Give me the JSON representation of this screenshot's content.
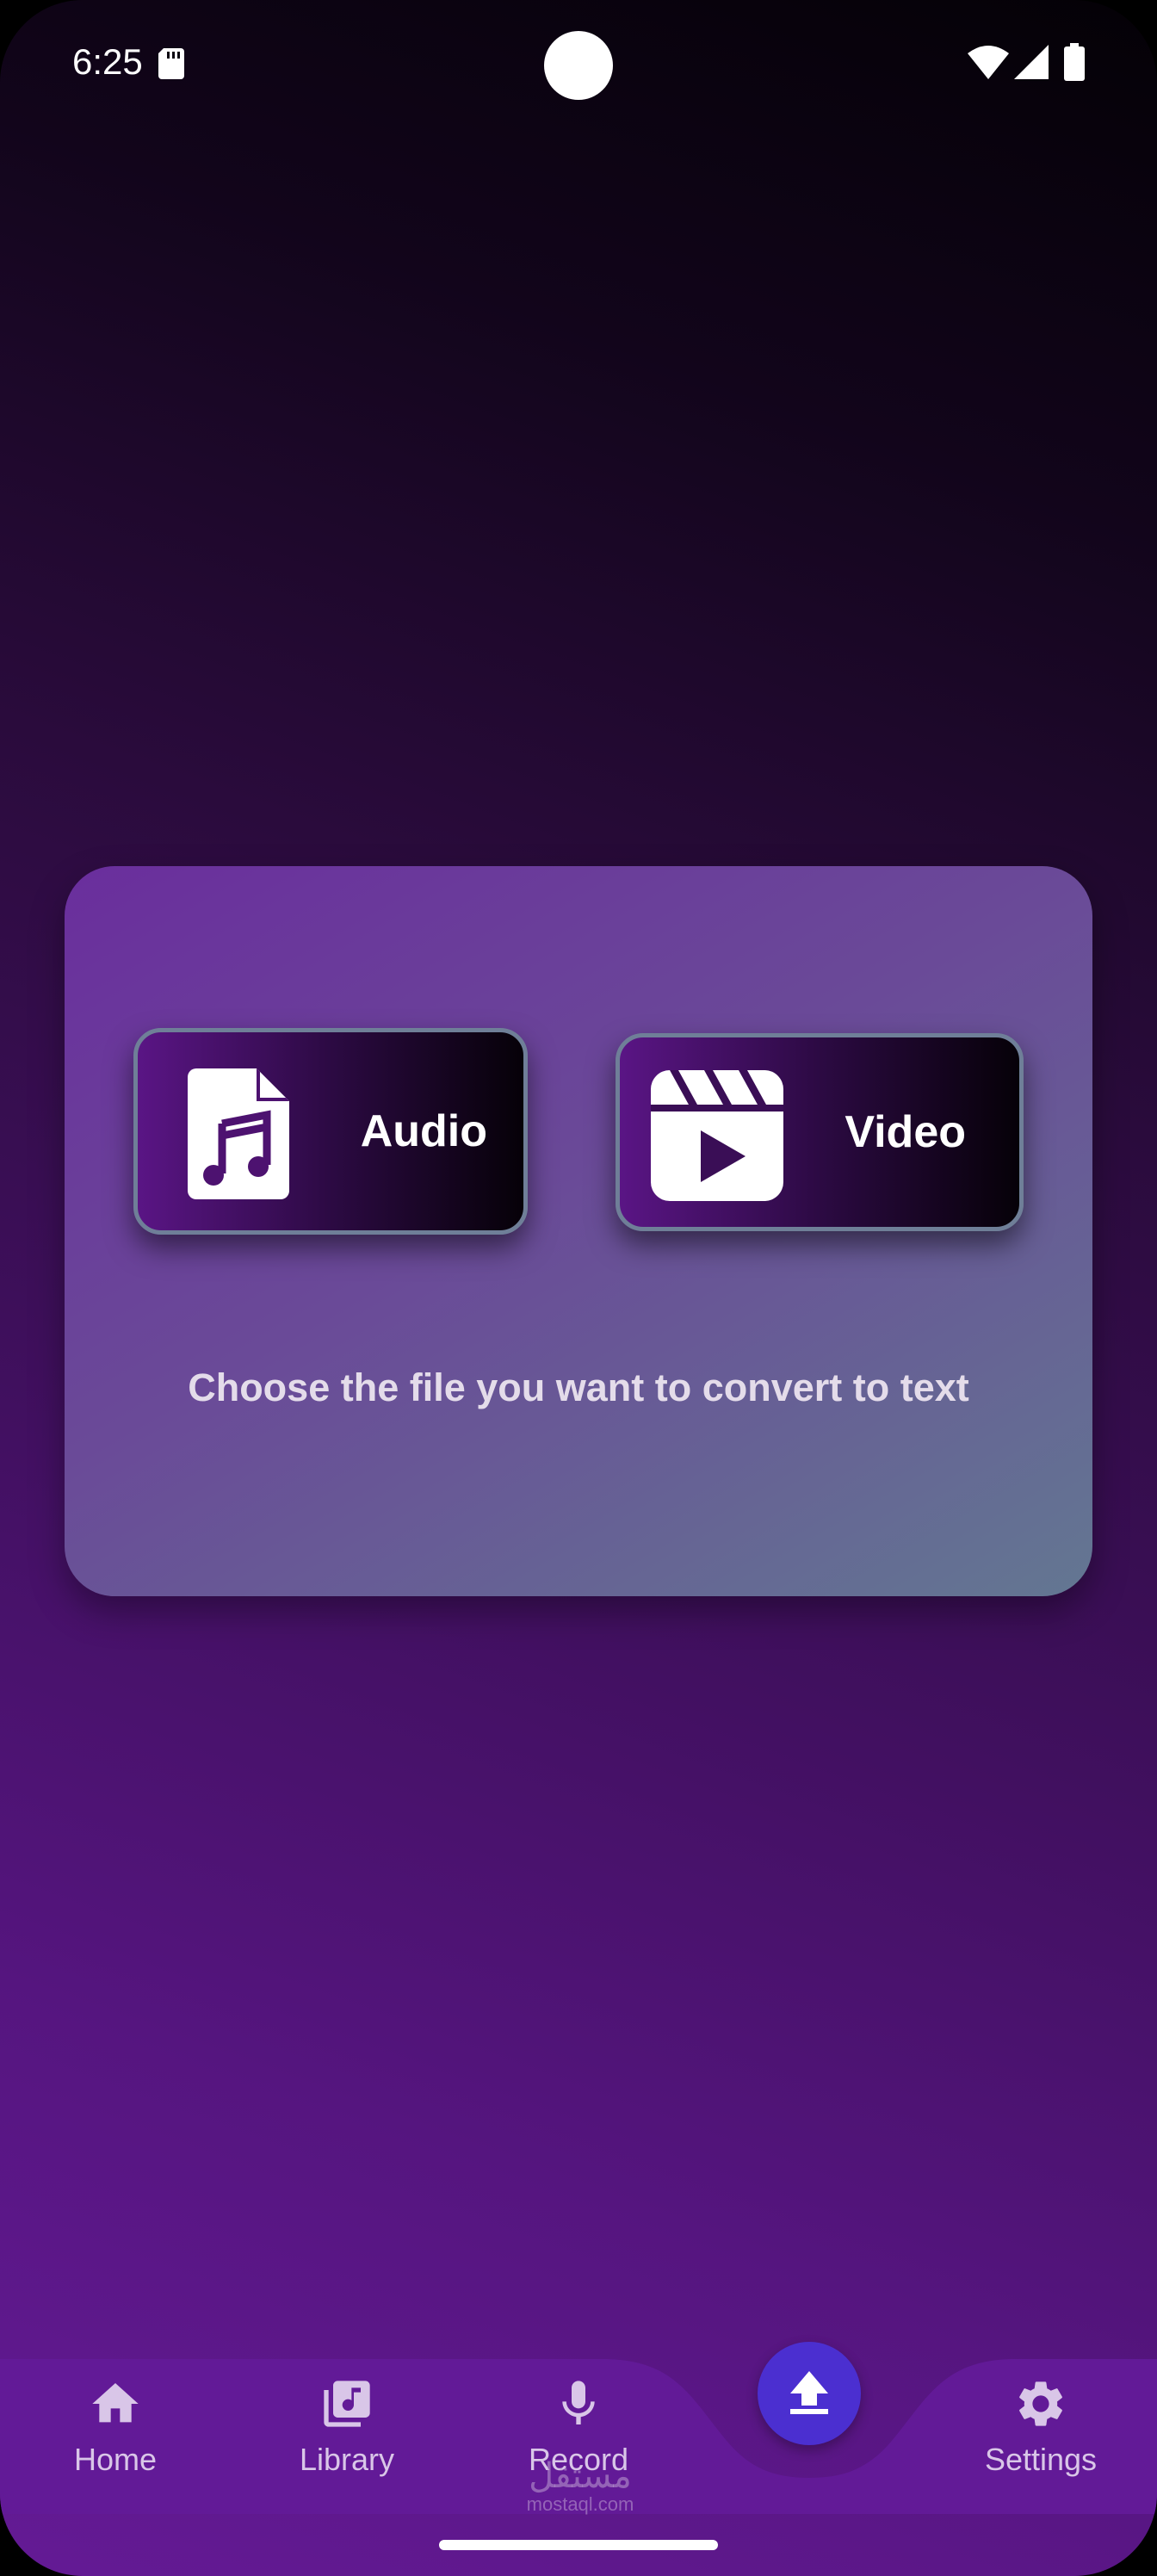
{
  "status_bar": {
    "time": "6:25",
    "icons": [
      "sd-card-icon",
      "wifi-icon",
      "signal-icon",
      "battery-icon"
    ]
  },
  "upload_card": {
    "audio_label": "Audio",
    "video_label": "Video",
    "caption": "Choose the file you want to convert to text",
    "icons": [
      "audio-file-icon",
      "video-clip-icon"
    ]
  },
  "bottom_nav": {
    "items": [
      {
        "label": "Home",
        "icon": "home-icon"
      },
      {
        "label": "Library",
        "icon": "library-music-icon"
      },
      {
        "label": "Record",
        "icon": "microphone-icon"
      },
      {
        "label": "Settings",
        "icon": "gear-icon"
      }
    ],
    "fab_icon": "upload-icon"
  },
  "watermark": {
    "arabic": "مستقل",
    "latin": "mostaql.com"
  },
  "colors": {
    "accent": "#4b2fd0",
    "nav_background": "#621a97",
    "card_start": "#6a2e9d",
    "card_end": "#637792"
  }
}
